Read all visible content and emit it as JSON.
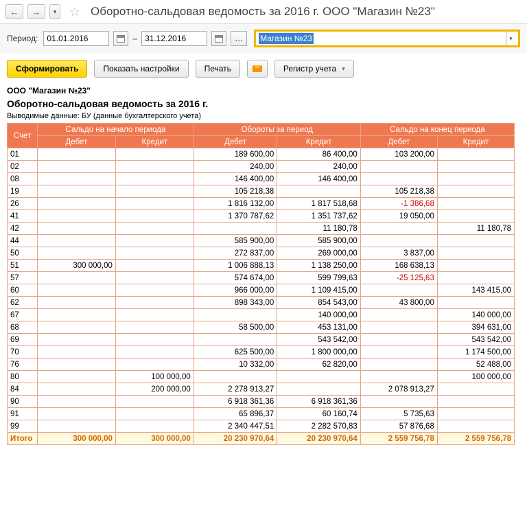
{
  "title": "Оборотно-сальдовая ведомость за 2016 г. ООО \"Магазин №23\"",
  "period": {
    "label": "Период:",
    "from": "01.01.2016",
    "to": "31.12.2016",
    "dash": "–"
  },
  "org_field": {
    "value": "Магазин №23"
  },
  "toolbar": {
    "form": "Сформировать",
    "settings": "Показать настройки",
    "print": "Печать",
    "register": "Регистр учета"
  },
  "report": {
    "org": "ООО \"Магазин №23\"",
    "title": "Оборотно-сальдовая ведомость за 2016 г.",
    "sub": "Выводимые данные:  БУ (данные бухгалтерского учета)"
  },
  "columns": {
    "c0": "Счет",
    "g1": "Сальдо на начало периода",
    "g2": "Обороты за период",
    "g3": "Сальдо на конец периода",
    "debit": "Дебет",
    "credit": "Кредит"
  },
  "rows": [
    {
      "acct": "01",
      "d1": "",
      "c1": "",
      "d2": "189 600,00",
      "c2": "86 400,00",
      "d3": "103 200,00",
      "c3": ""
    },
    {
      "acct": "02",
      "d1": "",
      "c1": "",
      "d2": "240,00",
      "c2": "240,00",
      "d3": "",
      "c3": ""
    },
    {
      "acct": "08",
      "d1": "",
      "c1": "",
      "d2": "146 400,00",
      "c2": "146 400,00",
      "d3": "",
      "c3": ""
    },
    {
      "acct": "19",
      "d1": "",
      "c1": "",
      "d2": "105 218,38",
      "c2": "",
      "d3": "105 218,38",
      "c3": ""
    },
    {
      "acct": "26",
      "d1": "",
      "c1": "",
      "d2": "1 816 132,00",
      "c2": "1 817 518,68",
      "d3": "-1 386,68",
      "c3": "",
      "d3neg": true
    },
    {
      "acct": "41",
      "d1": "",
      "c1": "",
      "d2": "1 370 787,62",
      "c2": "1 351 737,62",
      "d3": "19 050,00",
      "c3": ""
    },
    {
      "acct": "42",
      "d1": "",
      "c1": "",
      "d2": "",
      "c2": "11 180,78",
      "d3": "",
      "c3": "11 180,78"
    },
    {
      "acct": "44",
      "d1": "",
      "c1": "",
      "d2": "585 900,00",
      "c2": "585 900,00",
      "d3": "",
      "c3": ""
    },
    {
      "acct": "50",
      "d1": "",
      "c1": "",
      "d2": "272 837,00",
      "c2": "269 000,00",
      "d3": "3 837,00",
      "c3": ""
    },
    {
      "acct": "51",
      "d1": "300 000,00",
      "c1": "",
      "d2": "1 006 888,13",
      "c2": "1 138 250,00",
      "d3": "168 638,13",
      "c3": ""
    },
    {
      "acct": "57",
      "d1": "",
      "c1": "",
      "d2": "574 674,00",
      "c2": "599 799,63",
      "d3": "-25 125,63",
      "c3": "",
      "d3neg": true
    },
    {
      "acct": "60",
      "d1": "",
      "c1": "",
      "d2": "966 000,00",
      "c2": "1 109 415,00",
      "d3": "",
      "c3": "143 415,00"
    },
    {
      "acct": "62",
      "d1": "",
      "c1": "",
      "d2": "898 343,00",
      "c2": "854 543,00",
      "d3": "43 800,00",
      "c3": ""
    },
    {
      "acct": "67",
      "d1": "",
      "c1": "",
      "d2": "",
      "c2": "140 000,00",
      "d3": "",
      "c3": "140 000,00"
    },
    {
      "acct": "68",
      "d1": "",
      "c1": "",
      "d2": "58 500,00",
      "c2": "453 131,00",
      "d3": "",
      "c3": "394 631,00"
    },
    {
      "acct": "69",
      "d1": "",
      "c1": "",
      "d2": "",
      "c2": "543 542,00",
      "d3": "",
      "c3": "543 542,00"
    },
    {
      "acct": "70",
      "d1": "",
      "c1": "",
      "d2": "625 500,00",
      "c2": "1 800 000,00",
      "d3": "",
      "c3": "1 174 500,00"
    },
    {
      "acct": "76",
      "d1": "",
      "c1": "",
      "d2": "10 332,00",
      "c2": "62 820,00",
      "d3": "",
      "c3": "52 488,00"
    },
    {
      "acct": "80",
      "d1": "",
      "c1": "100 000,00",
      "d2": "",
      "c2": "",
      "d3": "",
      "c3": "100 000,00"
    },
    {
      "acct": "84",
      "d1": "",
      "c1": "200 000,00",
      "d2": "2 278 913,27",
      "c2": "",
      "d3": "2 078 913,27",
      "c3": ""
    },
    {
      "acct": "90",
      "d1": "",
      "c1": "",
      "d2": "6 918 361,36",
      "c2": "6 918 361,36",
      "d3": "",
      "c3": ""
    },
    {
      "acct": "91",
      "d1": "",
      "c1": "",
      "d2": "65 896,37",
      "c2": "60 160,74",
      "d3": "5 735,63",
      "c3": ""
    },
    {
      "acct": "99",
      "d1": "",
      "c1": "",
      "d2": "2 340 447,51",
      "c2": "2 282 570,83",
      "d3": "57 876,68",
      "c3": ""
    }
  ],
  "total": {
    "label": "Итого",
    "d1": "300 000,00",
    "c1": "300 000,00",
    "d2": "20 230 970,64",
    "c2": "20 230 970,64",
    "d3": "2 559 756,78",
    "c3": "2 559 756,78"
  }
}
